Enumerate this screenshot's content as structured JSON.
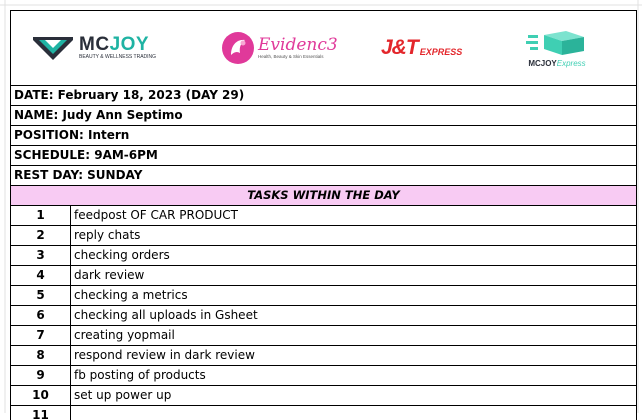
{
  "logos": {
    "mcjoy": {
      "name": "MC",
      "name_accent": "JOY",
      "tagline": "BEAUTY & WELLNESS TRADING",
      "color": "#2a2f3a",
      "accent": "#1fb3a3"
    },
    "evidence": {
      "name": "Evidenc3",
      "tagline": "Health, Beauty & Skin Essentials",
      "color": "#e0399a"
    },
    "jt": {
      "name": "J&T",
      "suffix": "EXPRESS",
      "color": "#e3262b"
    },
    "mcjoy_express": {
      "name": "MCJOY",
      "suffix": "Express",
      "color": "#3fcfb3"
    }
  },
  "info": {
    "date": "DATE: February 18, 2023 (DAY 29)",
    "name": "NAME: Judy Ann Septimo",
    "position": "POSITION: Intern",
    "schedule": "SCHEDULE: 9AM-6PM",
    "rest_day": "REST DAY: SUNDAY"
  },
  "tasks_header": "TASKS WITHIN THE DAY",
  "tasks": [
    {
      "num": "1",
      "text": "feedpost OF CAR PRODUCT"
    },
    {
      "num": "2",
      "text": "reply chats"
    },
    {
      "num": "3",
      "text": "checking orders"
    },
    {
      "num": "4",
      "text": "dark review"
    },
    {
      "num": "5",
      "text": "checking a metrics"
    },
    {
      "num": "6",
      "text": "checking all uploads in Gsheet"
    },
    {
      "num": "7",
      "text": "creating yopmail"
    },
    {
      "num": "8",
      "text": "respond review in dark review"
    },
    {
      "num": "9",
      "text": "fb posting of products"
    },
    {
      "num": "10",
      "text": "set up power up"
    },
    {
      "num": "11",
      "text": ""
    }
  ],
  "colors": {
    "header_fill": "#f8cbf3",
    "grid": "#e1e1e1",
    "border": "#000000"
  }
}
